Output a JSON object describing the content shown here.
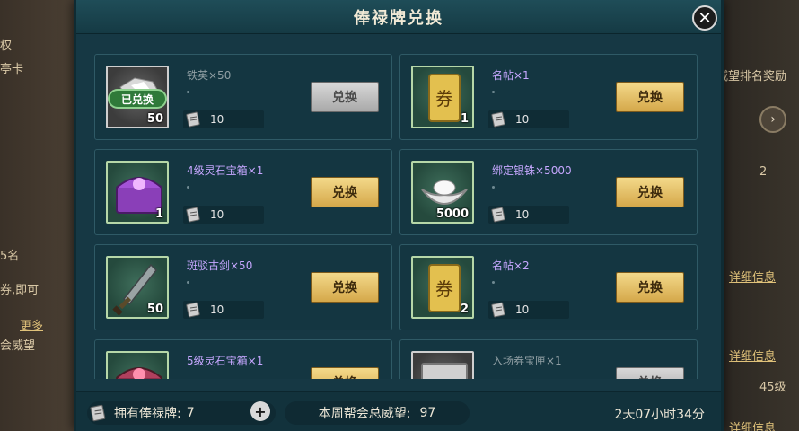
{
  "dialog": {
    "title": "俸禄牌兑换",
    "close_label": "✕"
  },
  "background": {
    "left_texts": [
      "权",
      "亭卡",
      "5名",
      "券,即可",
      "更多",
      "会威望"
    ],
    "right_texts": [
      "威望排名奖励",
      "2",
      "详细信息",
      "详细信息",
      "45级",
      "详细信息"
    ],
    "right_button": "›"
  },
  "items": [
    {
      "name": "铁英×50",
      "qty": "50",
      "cost": "10",
      "button": "兑换",
      "redeemed_badge": "已兑换",
      "state": "redeemed",
      "icon": "iron-ore-icon"
    },
    {
      "name": "名帖×1",
      "qty": "1",
      "cost": "10",
      "button": "兑换",
      "state": "available",
      "icon": "ticket-card-icon"
    },
    {
      "name": "4级灵石宝箱×1",
      "qty": "1",
      "cost": "10",
      "button": "兑换",
      "state": "available",
      "icon": "purple-chest-icon"
    },
    {
      "name": "绑定银铢×5000",
      "qty": "5000",
      "cost": "10",
      "button": "兑换",
      "state": "available",
      "icon": "silver-ingot-icon"
    },
    {
      "name": "斑驳古剑×50",
      "qty": "50",
      "cost": "10",
      "button": "兑换",
      "state": "available",
      "icon": "ancient-sword-icon"
    },
    {
      "name": "名帖×2",
      "qty": "2",
      "cost": "10",
      "button": "兑换",
      "state": "available",
      "icon": "ticket-card-icon"
    },
    {
      "name": "5级灵石宝箱×1",
      "qty": "",
      "cost": "",
      "button": "兑换",
      "state": "available",
      "icon": "purple-chest-icon"
    },
    {
      "name": "入场券宝匣×1",
      "qty": "",
      "cost": "",
      "button": "兑换",
      "state": "unavailable",
      "icon": "gray-box-icon"
    }
  ],
  "footer": {
    "own_label": "拥有俸禄牌:",
    "own_value": "7",
    "plus_label": "+",
    "prestige_label": "本周帮会总威望:",
    "prestige_value": "97",
    "timer": "2天07小时34分"
  },
  "colors": {
    "dialog_bg": "#163844",
    "card_border": "#2f5a66",
    "button_gold": "#e6c26b",
    "item_name_purple": "#c6a7ff",
    "redeemed_green": "#2f7a39"
  }
}
